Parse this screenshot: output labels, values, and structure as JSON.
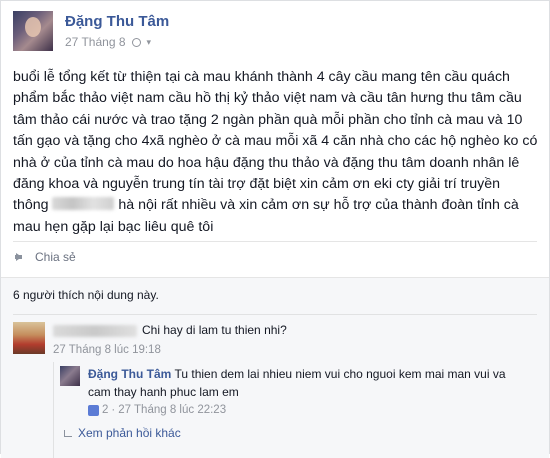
{
  "post": {
    "author": "Đặng Thu Tâm",
    "date": "27 Tháng 8",
    "body_part1": "buổi lễ tổng kết từ thiện tại cà mau khánh thành 4 cây cầu mang tên cầu quách phẩm bắc thảo việt nam cầu hồ thị kỷ thảo việt nam và cầu tân hưng thu tâm cầu tâm thảo cái nước và trao tặng 2 ngàn phần quà mỗi phần cho tỉnh cà mau và 10 tấn gạo và tặng cho 4xã nghèo ở cà mau mỗi xã 4 căn nhà cho các hộ nghèo ko có nhà ở của tỉnh cà mau do hoa hậu đặng thu thảo và đặng thu tâm doanh nhân lê đăng khoa và nguyễn trung tín tài trợ đặt biệt xin cảm ơn eki cty giải trí truyền thông",
    "body_part2": " hà nội rất nhiều và xin cảm ơn sự hỗ trợ của thành đoàn tỉnh cà mau hẹn gặp lại bạc liêu quê tôi",
    "share_label": "Chia sẻ",
    "likes_text": "6 người thích nội dung này."
  },
  "comments": [
    {
      "text": "Chi hay di lam tu thien nhi?",
      "time": "27 Tháng 8 lúc 19:18"
    }
  ],
  "reply": {
    "author": "Đặng Thu Tâm",
    "text": "Tu thien dem lai nhieu niem vui cho nguoi kem mai man vui va cam thay hanh phuc lam em",
    "like_count": "2",
    "time": "27 Tháng 8 lúc 22:23",
    "more_label": "Xem phản hồi khác"
  },
  "colors": {
    "link": "#3b5998",
    "meta": "#90949c",
    "comment_bg": "#f6f7f9"
  }
}
